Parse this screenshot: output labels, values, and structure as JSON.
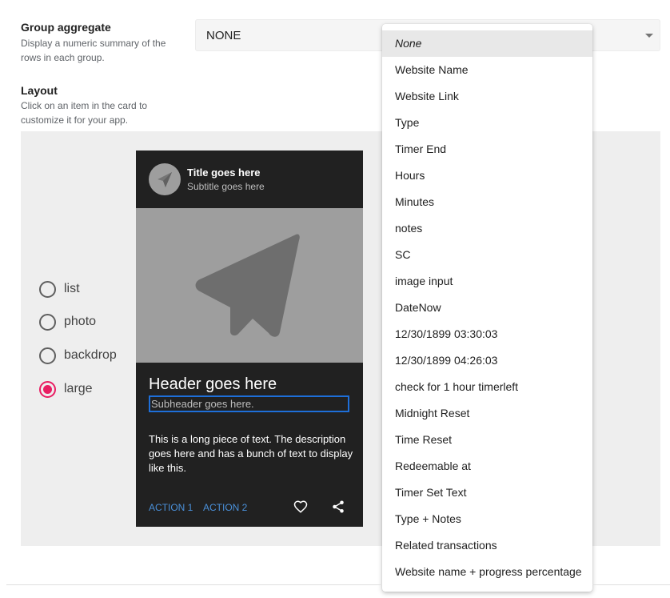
{
  "group_aggregate": {
    "title": "Group aggregate",
    "description": "Display a numeric summary of the rows in each group.",
    "selected_value": "NONE"
  },
  "layout": {
    "title": "Layout",
    "description": "Click on an item in the card to customize it for your app.",
    "options": [
      {
        "label": "list",
        "selected": false
      },
      {
        "label": "photo",
        "selected": false
      },
      {
        "label": "backdrop",
        "selected": false
      },
      {
        "label": "large",
        "selected": true
      }
    ]
  },
  "card": {
    "title": "Title goes here",
    "subtitle": "Subtitle goes here",
    "header": "Header goes here",
    "subheader": "Subheader goes here.",
    "description": "This is a long piece of text. The description goes here and has a bunch of text to display like this.",
    "actions": [
      "ACTION 1",
      "ACTION 2"
    ],
    "icons": [
      "heart-icon",
      "share-icon"
    ]
  },
  "dropdown": {
    "options": [
      "None",
      "Website Name",
      "Website Link",
      "Type",
      "Timer End",
      "Hours",
      "Minutes",
      "notes",
      "SC",
      "image input",
      "DateNow",
      "12/30/1899 03:30:03",
      "12/30/1899 04:26:03",
      "check for 1 hour timerleft",
      "Midnight Reset",
      "Time Reset",
      "Redeemable at",
      "Timer Set Text",
      "Type + Notes",
      "Related transactions",
      "Website name + progress percentage"
    ],
    "highlighted": "None"
  },
  "colors": {
    "accent": "#e91e63",
    "link": "#4a90d9",
    "card_bg": "#212121",
    "focus_outline": "#1e6fd9"
  }
}
